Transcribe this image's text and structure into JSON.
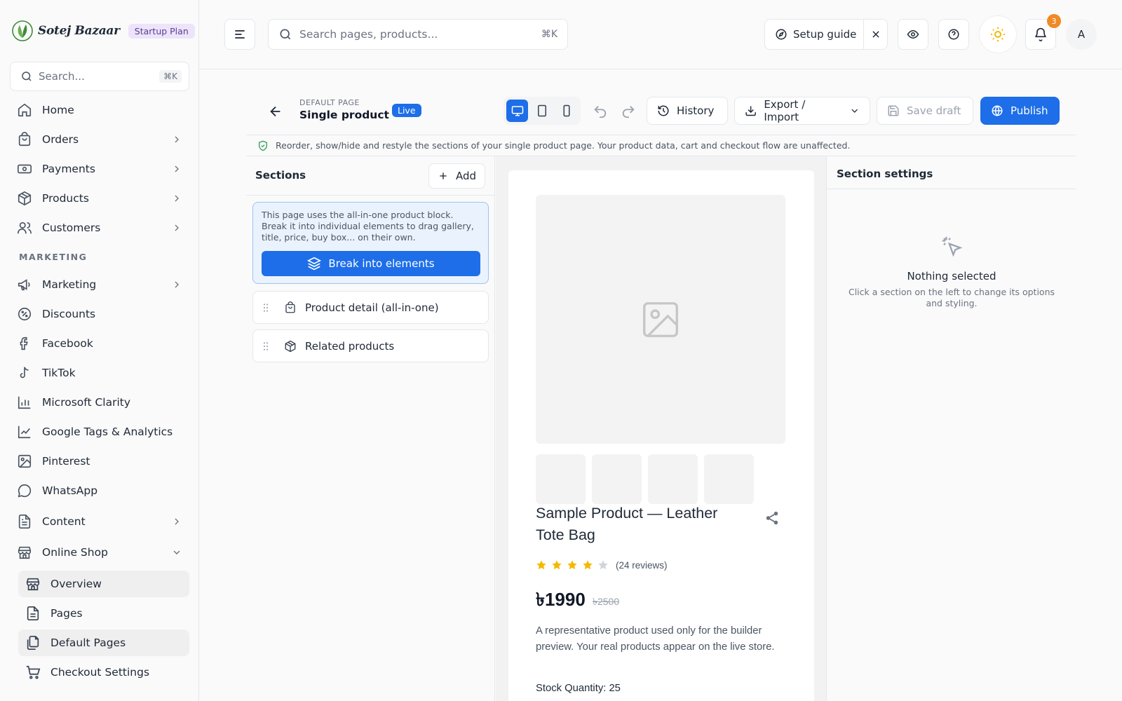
{
  "brand": {
    "name": "Sotej Bazaar",
    "plan": "Startup Plan"
  },
  "sidebar": {
    "search_placeholder": "Search...",
    "search_shortcut": "⌘K",
    "items": [
      {
        "label": "Home",
        "icon": "home-icon"
      },
      {
        "label": "Orders",
        "icon": "shopping-bag-icon"
      },
      {
        "label": "Payments",
        "icon": "banknote-icon"
      },
      {
        "label": "Products",
        "icon": "package-icon"
      },
      {
        "label": "Customers",
        "icon": "users-icon"
      }
    ],
    "section_label": "MARKETING",
    "marketing_items": [
      {
        "label": "Marketing",
        "icon": "megaphone-icon"
      },
      {
        "label": "Discounts",
        "icon": "discount-icon"
      },
      {
        "label": "Facebook",
        "icon": "facebook-icon"
      },
      {
        "label": "TikTok",
        "icon": "tiktok-icon"
      },
      {
        "label": "Microsoft Clarity",
        "icon": "bar-chart-icon"
      },
      {
        "label": "Google Tags & Analytics",
        "icon": "line-chart-icon"
      },
      {
        "label": "Pinterest",
        "icon": "image-icon"
      },
      {
        "label": "WhatsApp",
        "icon": "chat-icon"
      },
      {
        "label": "Content",
        "icon": "document-icon"
      },
      {
        "label": "Online Shop",
        "icon": "store-icon"
      }
    ],
    "sub_items": [
      {
        "label": "Overview",
        "icon": "store-icon"
      },
      {
        "label": "Pages",
        "icon": "document-icon"
      },
      {
        "label": "Default Pages",
        "icon": "copy-icon"
      },
      {
        "label": "Checkout Settings",
        "icon": "cart-icon"
      }
    ]
  },
  "topbar": {
    "search_placeholder": "Search pages, products...",
    "search_shortcut": "⌘K",
    "setup_guide": "Setup guide",
    "notification_count": "3",
    "avatar_initial": "A"
  },
  "editor": {
    "crumb": "DEFAULT PAGE",
    "title": "Single product",
    "status": "Live",
    "history": "History",
    "export_import": "Export / Import",
    "save_draft": "Save draft",
    "publish": "Publish",
    "info": "Reorder, show/hide and restyle the sections of your single product page. Your product data, cart and checkout flow are unaffected."
  },
  "sections": {
    "title": "Sections",
    "add": "Add",
    "notice": "This page uses the all-in-one product block. Break it into individual elements to drag gallery, title, price, buy box... on their own.",
    "break_button": "Break into elements",
    "items": [
      {
        "label": "Product detail (all-in-one)",
        "icon": "shopping-bag-icon"
      },
      {
        "label": "Related products",
        "icon": "package-icon"
      }
    ]
  },
  "preview": {
    "product_title": "Sample Product — Leather Tote Bag",
    "rating": 4,
    "rating_max": 5,
    "reviews": "(24 reviews)",
    "price": "৳1990",
    "old_price": "৳2500",
    "description": "A representative product used only for the builder preview. Your real products appear on the live store.",
    "stock": "Stock Quantity: 25"
  },
  "settings": {
    "title": "Section settings",
    "empty_title": "Nothing selected",
    "empty_desc": "Click a section on the left to change its options and styling."
  },
  "colors": {
    "accent": "#1d6ee8",
    "star": "#f5b800",
    "badge": "#f08a24",
    "plan_bg": "#ede4fb"
  }
}
